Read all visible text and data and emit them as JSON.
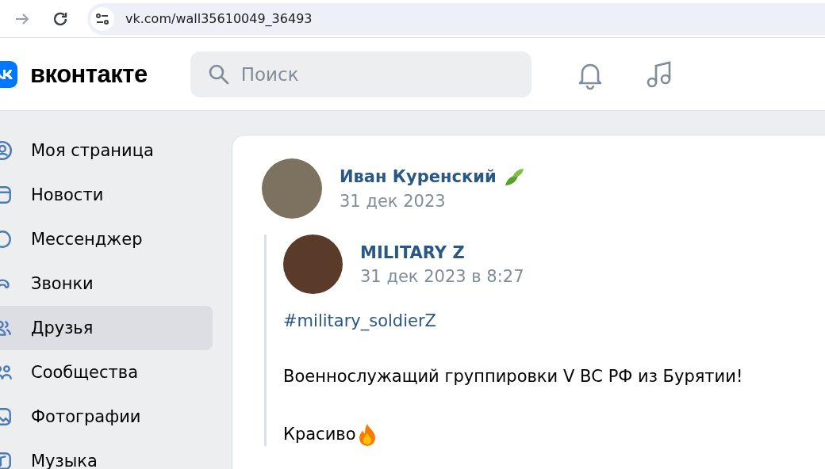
{
  "browser": {
    "url": "vk.com/wall35610049_36493"
  },
  "header": {
    "logo": "вконтакте",
    "search": {
      "placeholder": "Поиск"
    }
  },
  "sidebar": {
    "items": [
      {
        "label": "Моя страница",
        "kind": "profile",
        "hovered": false
      },
      {
        "label": "Новости",
        "kind": "news",
        "hovered": false
      },
      {
        "label": "Мессенджер",
        "kind": "messenger",
        "hovered": false
      },
      {
        "label": "Звонки",
        "kind": "calls",
        "hovered": false
      },
      {
        "label": "Друзья",
        "kind": "friends",
        "hovered": true
      },
      {
        "label": "Сообщества",
        "kind": "communities",
        "hovered": false
      },
      {
        "label": "Фотографии",
        "kind": "photos",
        "hovered": false
      },
      {
        "label": "Музыка",
        "kind": "music",
        "hovered": false
      }
    ]
  },
  "post": {
    "author": "Иван Куренский",
    "date": "31 дек 2023",
    "repost": {
      "author": "MILITARY Z",
      "date": "31 дек 2023 в 8:27",
      "hashtag": "#military_soldierZ",
      "paragraphs": [
        "Военнослужащий группировки V ВС РФ из Бурятии!",
        "Красиво"
      ]
    }
  }
}
